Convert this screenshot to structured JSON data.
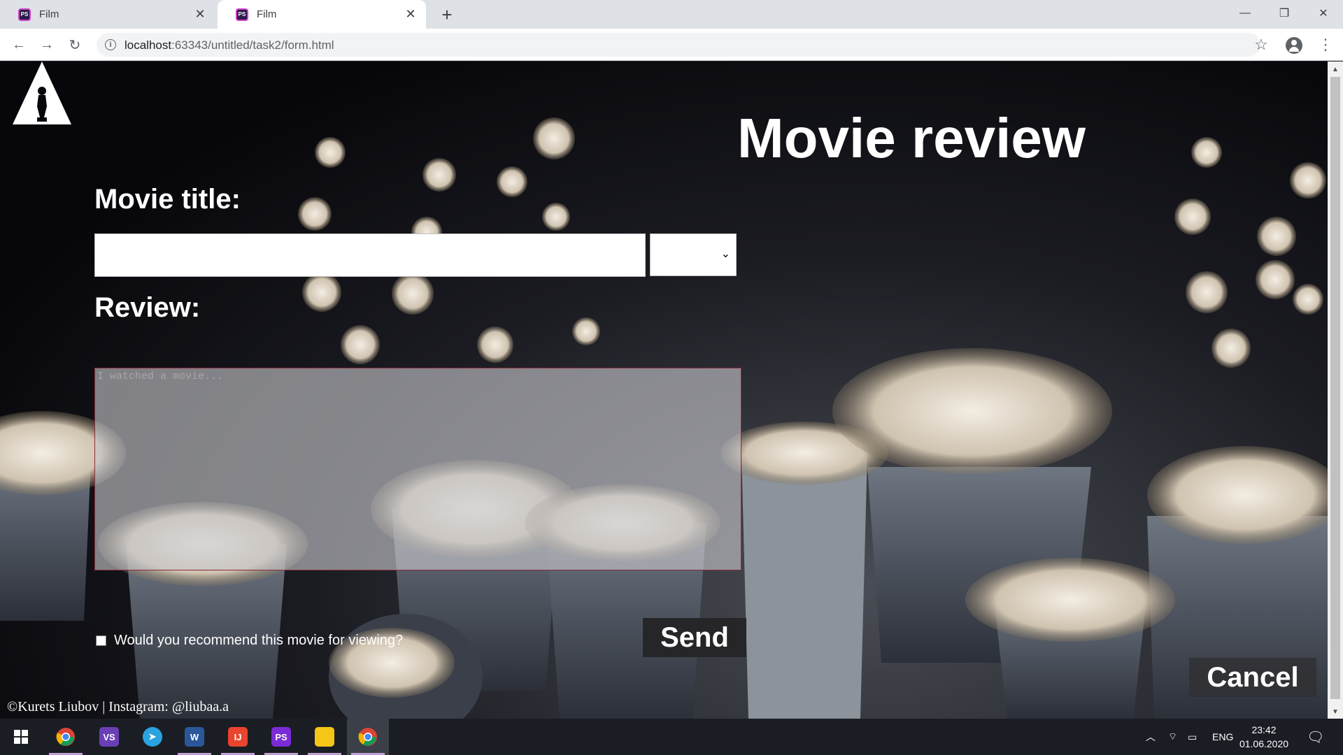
{
  "browser": {
    "tabs": [
      {
        "title": "Film",
        "favicon": "phpstorm-icon",
        "active": false
      },
      {
        "title": "Film",
        "favicon": "phpstorm-icon",
        "active": true
      }
    ],
    "favicon_text": "PS",
    "new_tab_icon": "+",
    "url_host": "localhost",
    "url_rest": ":63343/untitled/task2/form.html",
    "window_controls": [
      "minimize",
      "restore",
      "close"
    ]
  },
  "page": {
    "title": "Movie review",
    "movie_title_label": "Movie title:",
    "movie_title_value": "",
    "select_value": "",
    "review_label": "Review:",
    "review_placeholder": "I watched a movie...",
    "recommend_label": "Would you recommend this movie for viewing?",
    "recommend_checked": false,
    "send_label": "Send",
    "cancel_label": "Cancel",
    "footer": "©Kurets Liubov | Instagram: @liubaa.a"
  },
  "taskbar": {
    "apps": [
      "start-icon",
      "chrome-icon",
      "visual-studio-icon",
      "telegram-icon",
      "word-icon",
      "intellij-icon",
      "phpstorm-icon",
      "file-explorer-icon",
      "chrome-icon"
    ],
    "tray_language": "ENG",
    "time": "23:42",
    "date": "01.06.2020"
  },
  "colors": {
    "page_background": "#07070b",
    "text_light": "#ffffff",
    "button_dark": "#262628",
    "textarea_border": "#8b2c38",
    "taskbar": "#1a1e24"
  }
}
